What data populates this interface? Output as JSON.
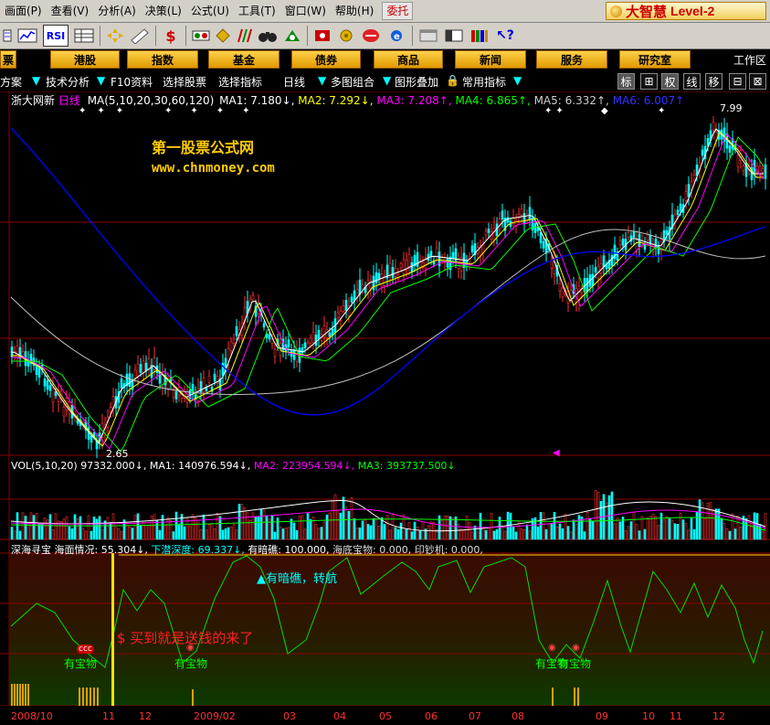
{
  "menu": {
    "items": [
      "画面(P)",
      "查看(V)",
      "分析(A)",
      "决策(L)",
      "公式(U)",
      "工具(T)",
      "窗口(W)",
      "帮助(H)"
    ],
    "weituo": "委托",
    "brand_cn": "大智慧",
    "brand_level": "Level-2"
  },
  "toolbar": {
    "rsi_label": "RSI",
    "icons": [
      "list-icon",
      "kline-icon",
      "rsi-icon",
      "table-icon",
      "move-icon",
      "ruler-icon",
      "dollar-icon",
      "tape-icon",
      "diamond-icon",
      "bars-icon",
      "binoculars-icon",
      "stamp-icon",
      "refresh-icon",
      "gear-icon",
      "globe-icon",
      "ie-icon",
      "window-icon",
      "layout-icon",
      "books-icon",
      "help-icon"
    ]
  },
  "nav": {
    "left_stub": "票",
    "buttons": [
      "港股",
      "指数",
      "基金",
      "债券",
      "商品",
      "新闻",
      "服务",
      "研究室"
    ],
    "workzone": "工作区"
  },
  "subbar": {
    "items": [
      "方案",
      "技术分析",
      "F10资料",
      "选择股票",
      "选择指标",
      "日线",
      "多图组合",
      "图形叠加",
      "常用指标"
    ],
    "right_buttons": [
      "标",
      "⊞",
      "权",
      "线",
      "移",
      "⊟",
      "⊠"
    ]
  },
  "chart_header": {
    "name": "浙大网新",
    "period": "日线",
    "ma_label": "MA(5,10,20,30,60,120)",
    "ma1": "MA1: 7.180↓,",
    "ma2": "MA2: 7.292↓,",
    "ma3": "MA3: 7.208↑,",
    "ma4": "MA4: 6.865↑,",
    "ma5": "MA5: 6.332↑,",
    "ma6": "MA6: 6.007↑"
  },
  "watermark": {
    "line1": "第一股票公式网",
    "line2": "www.chnmoney.com"
  },
  "price_labels": {
    "high": "7.99",
    "low": "2.65"
  },
  "volume_header": {
    "label": "VOL(5,10,20)",
    "vol": "97332.000↓,",
    "ma1": "MA1: 140976.594↓,",
    "ma2": "MA2: 223954.594↓,",
    "ma3": "MA3: 393737.500↓"
  },
  "indicator_header": {
    "name": "深海寻宝",
    "sea": "海面情况: 55.304↓,",
    "dive": "下潜深度: 69.337↓,",
    "reef": "有暗礁: 100.000,",
    "treasure": "海底宝物: 0.000,",
    "printer": "印钞机: 0.000,"
  },
  "annotations": {
    "reef_sign": "▲有暗礁，转航",
    "buy_msg": "$ 买到就是送钱的来了",
    "treasure_labels": [
      "有宝物",
      "有宝物",
      "有宝物",
      "有宝物"
    ],
    "ccc": "ccc"
  },
  "x_axis": {
    "labels": [
      "2008/10",
      "11",
      "12",
      "2009/02",
      "03",
      "04",
      "05",
      "06",
      "07",
      "08",
      "09",
      "10",
      "11",
      "12"
    ]
  },
  "colors": {
    "ma1": "#ffffff",
    "ma2": "#ffff00",
    "ma3": "#ff00ff",
    "ma4": "#00ff00",
    "ma5": "#c0c0c0",
    "ma6": "#0000ff",
    "up": "#ff3030",
    "down": "#00ffff",
    "grid": "#8b0000"
  }
}
